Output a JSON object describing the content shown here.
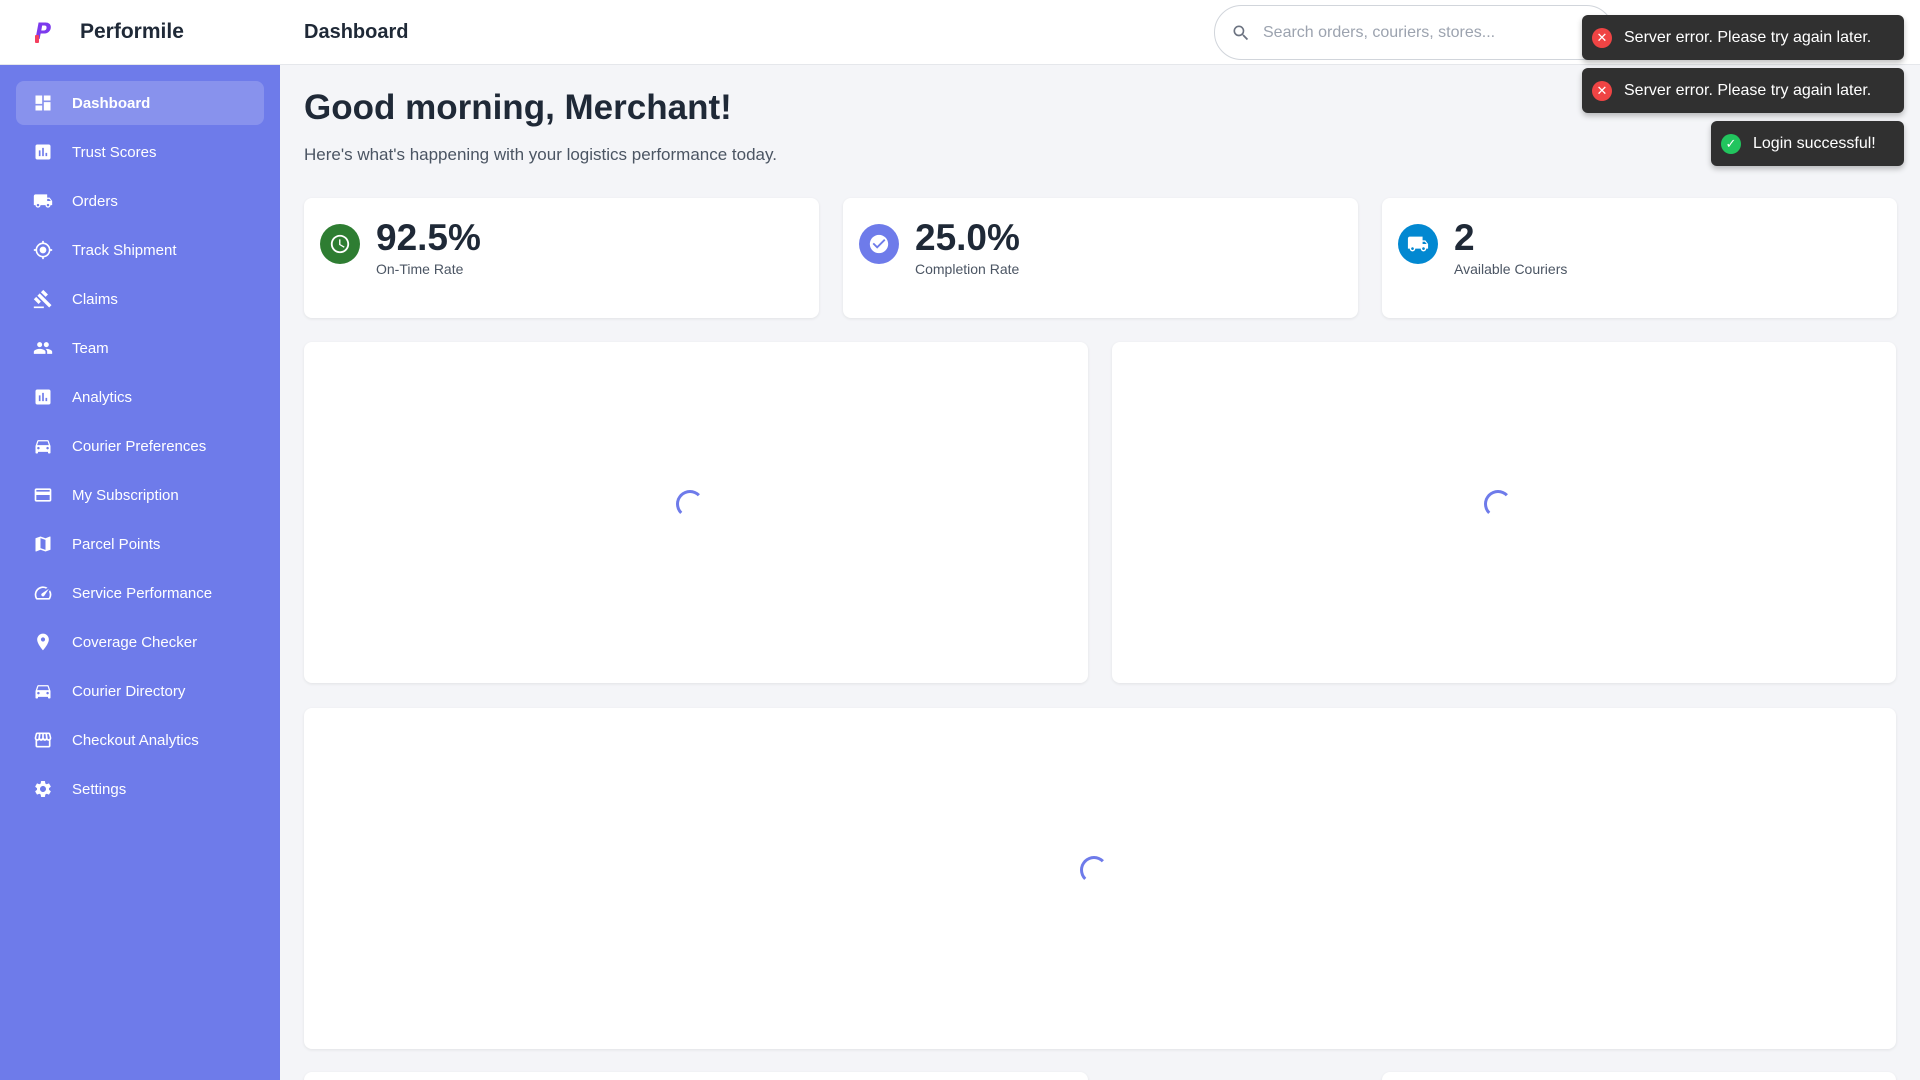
{
  "brand": {
    "name": "Performile",
    "logo_letter": "P"
  },
  "colors": {
    "sidebar": "#6e7bea",
    "accent": "#6e7bea",
    "on_time": "#2e7d32",
    "completion": "#6e7bea",
    "couriers": "#0288d1",
    "error": "#ef4444",
    "success": "#22c55e"
  },
  "sidebar": {
    "items": [
      {
        "label": "Dashboard",
        "icon": "dashboard-icon",
        "active": true
      },
      {
        "label": "Trust Scores",
        "icon": "bar-chart-icon"
      },
      {
        "label": "Orders",
        "icon": "truck-icon"
      },
      {
        "label": "Track Shipment",
        "icon": "gps-icon"
      },
      {
        "label": "Claims",
        "icon": "gavel-icon"
      },
      {
        "label": "Team",
        "icon": "people-icon"
      },
      {
        "label": "Analytics",
        "icon": "analytics-icon"
      },
      {
        "label": "Courier Preferences",
        "icon": "car-icon"
      },
      {
        "label": "My Subscription",
        "icon": "credit-card-icon"
      },
      {
        "label": "Parcel Points",
        "icon": "map-icon"
      },
      {
        "label": "Service Performance",
        "icon": "speedometer-icon"
      },
      {
        "label": "Coverage Checker",
        "icon": "location-pin-icon"
      },
      {
        "label": "Courier Directory",
        "icon": "car-icon"
      },
      {
        "label": "Checkout Analytics",
        "icon": "store-icon"
      },
      {
        "label": "Settings",
        "icon": "gear-icon"
      }
    ]
  },
  "header": {
    "title": "Dashboard",
    "search_placeholder": "Search orders, couriers, stores..."
  },
  "main": {
    "greeting": "Good morning, Merchant!",
    "subtitle": "Here's what's happening with your logistics performance today.",
    "stats": [
      {
        "value": "92.5%",
        "label": "On-Time Rate",
        "icon": "clock-icon"
      },
      {
        "value": "25.0%",
        "label": "Completion Rate",
        "icon": "check-circle-icon"
      },
      {
        "value": "2",
        "label": "Available Couriers",
        "icon": "truck-icon"
      }
    ]
  },
  "toasts": [
    {
      "message": "Server error. Please try again later.",
      "type": "error"
    },
    {
      "message": "Server error. Please try again later.",
      "type": "error"
    },
    {
      "message": "Login successful!",
      "type": "success"
    }
  ]
}
